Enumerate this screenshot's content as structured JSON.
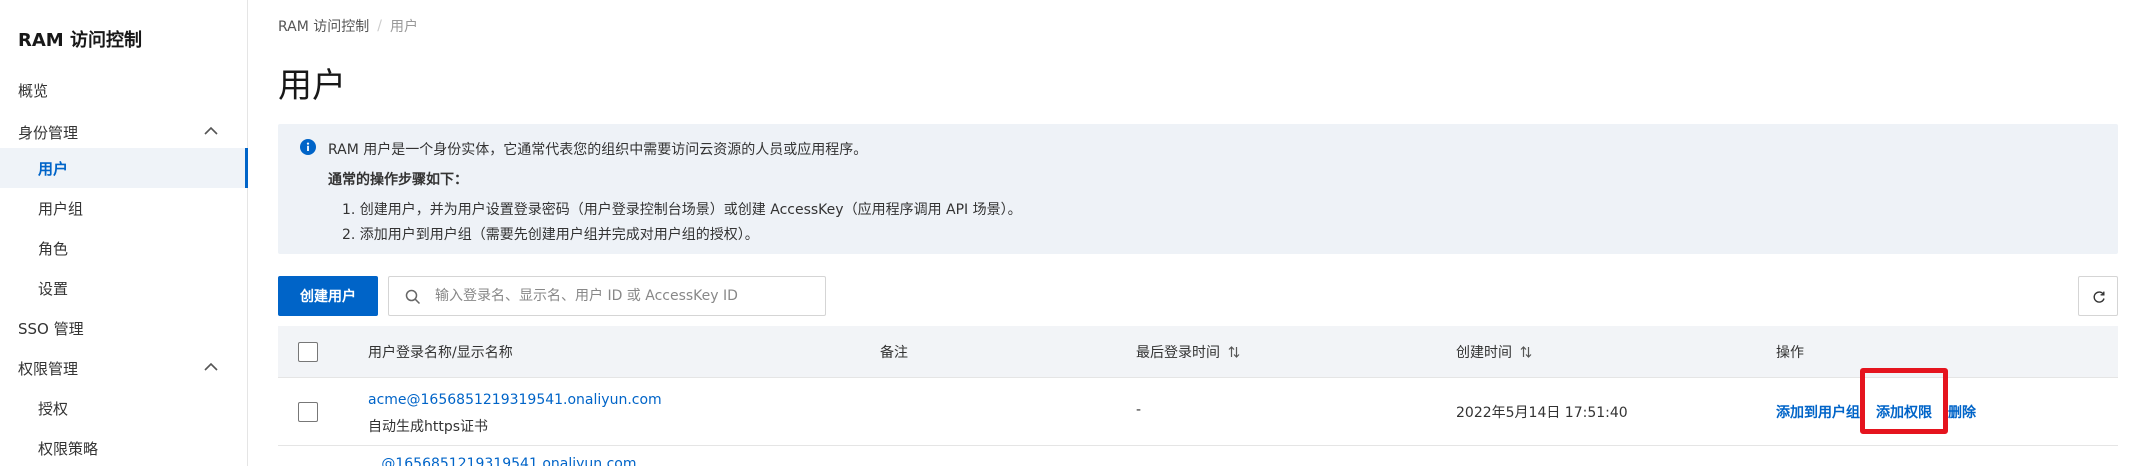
{
  "sidebar": {
    "title": "RAM 访问控制",
    "items": [
      {
        "label": "概览"
      },
      {
        "label": "身份管理"
      },
      {
        "label": "用户"
      },
      {
        "label": "用户组"
      },
      {
        "label": "角色"
      },
      {
        "label": "设置"
      },
      {
        "label": "SSO 管理"
      },
      {
        "label": "权限管理"
      },
      {
        "label": "授权"
      },
      {
        "label": "权限策略"
      }
    ]
  },
  "breadcrumb": {
    "root": "RAM 访问控制",
    "separator": "/",
    "current": "用户"
  },
  "page_title": "用户",
  "info": {
    "line1": "RAM 用户是一个身份实体，它通常代表您的组织中需要访问云资源的人员或应用程序。",
    "line2": "通常的操作步骤如下：",
    "line3": "1. 创建用户，并为用户设置登录密码（用户登录控制台场景）或创建 AccessKey（应用程序调用 API 场景）。",
    "line4": "2. 添加用户到用户组（需要先创建用户组并完成对用户组的授权）。"
  },
  "toolbar": {
    "create_label": "创建用户",
    "search_placeholder": "输入登录名、显示名、用户 ID 或 AccessKey ID"
  },
  "table": {
    "columns": {
      "name": "用户登录名称/显示名称",
      "note": "备注",
      "last_login": "最后登录时间",
      "created": "创建时间",
      "actions": "操作"
    },
    "rows": [
      {
        "login_name": "acme@1656851219319541.onaliyun.com",
        "display_name": "自动生成https证书",
        "note": "",
        "last_login": "-",
        "created": "2022年5月14日 17:51:40",
        "actions": {
          "add_to_group": "添加到用户组",
          "add_permission": "添加权限",
          "delete": "删除"
        }
      }
    ],
    "next_row_partial": "...@1656851219319541.onaliyun.com"
  },
  "colors": {
    "primary": "#0064c8",
    "highlight": "#e5141e",
    "info_bg": "#eef2f7"
  }
}
